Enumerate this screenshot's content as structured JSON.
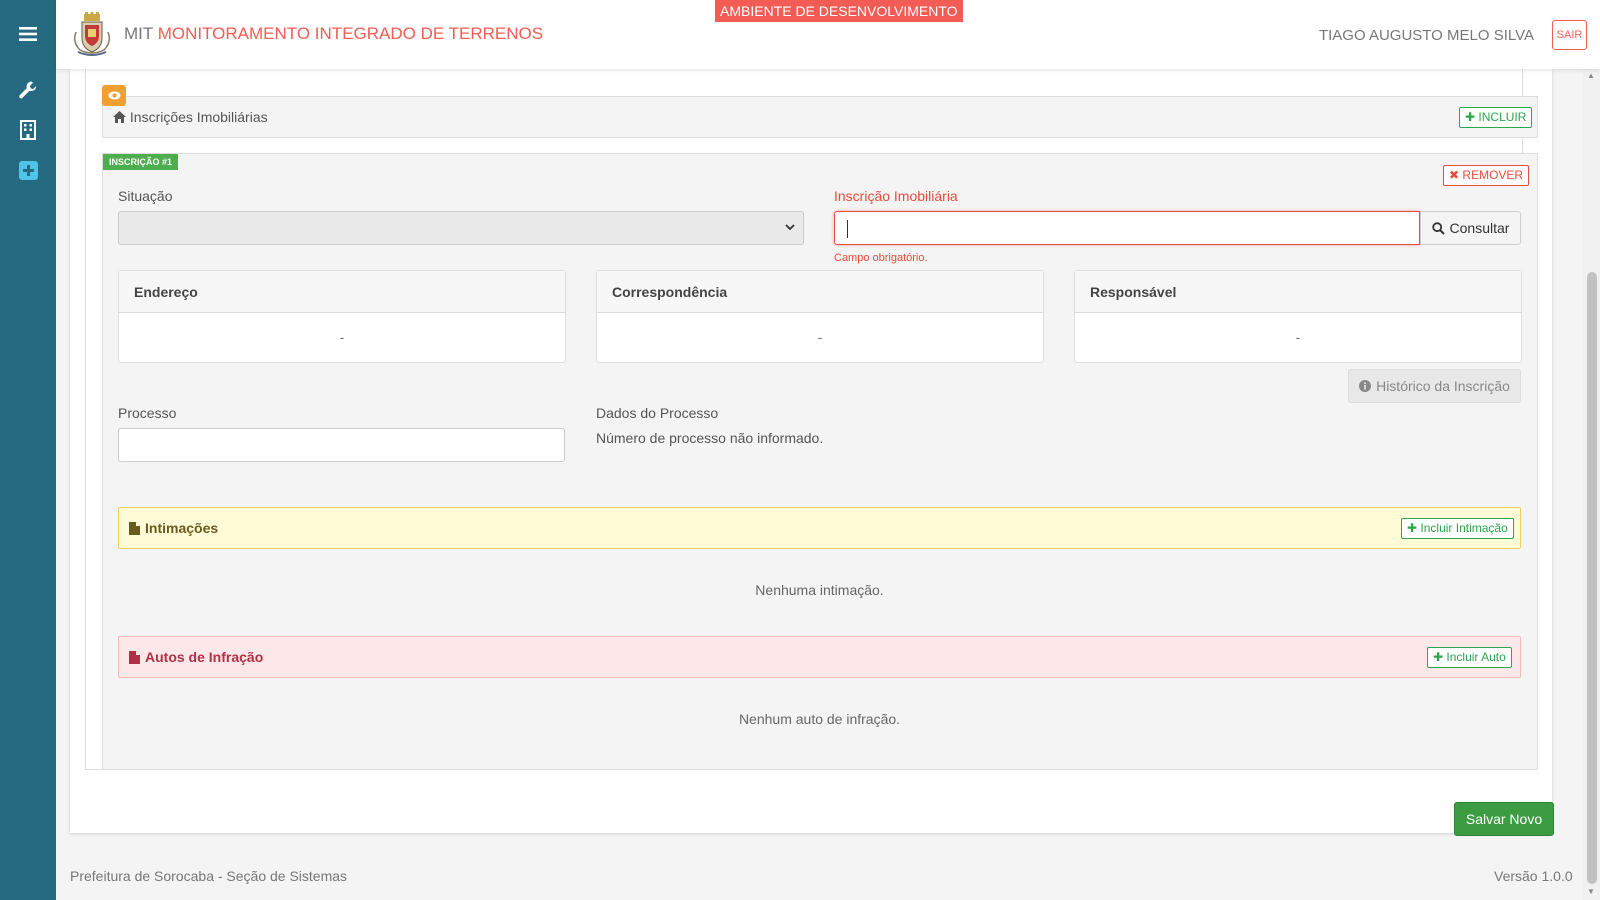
{
  "header": {
    "app_prefix": "MIT",
    "app_title": "MONITORAMENTO INTEGRADO DE TERRENOS",
    "environment_badge": "AMBIENTE DE DESENVOLVIMENTO",
    "user_name": "TIAGO AUGUSTO MELO SILVA",
    "logout_label": "SAIR"
  },
  "sidebar": {
    "items": [
      {
        "icon": "menu-icon"
      },
      {
        "icon": "wrench-icon"
      },
      {
        "icon": "building-icon"
      },
      {
        "icon": "plus-square-icon"
      }
    ]
  },
  "inscricoes": {
    "section_title": "Inscrições Imobiliárias",
    "include_label": "INCLUIR",
    "item_tag": "INSCRIÇÃO #1",
    "remove_label": "REMOVER",
    "situacao_label": "Situação",
    "situacao_value": "",
    "inscricao_label": "Inscrição Imobiliária",
    "inscricao_value": "",
    "consultar_label": "Consultar",
    "required_error": "Campo obrigatório.",
    "endereco_title": "Endereço",
    "endereco_value": "-",
    "correspondencia_title": "Correspondência",
    "correspondencia_value": "-",
    "responsavel_title": "Responsável",
    "responsavel_value": "-",
    "historico_label": "Histórico da Inscrição",
    "processo_label": "Processo",
    "processo_value": "",
    "dados_processo_label": "Dados do Processo",
    "dados_processo_value": "Número de processo não informado."
  },
  "intimacoes": {
    "title": "Intimações",
    "include_label": "Incluir Intimação",
    "empty_message": "Nenhuma intimação."
  },
  "autos": {
    "title": "Autos de Infração",
    "include_label": "Incluir Auto",
    "empty_message": "Nenhum auto de infração."
  },
  "actions": {
    "save_label": "Salvar Novo"
  },
  "footer": {
    "organization": "Prefeitura de Sorocaba - Seção de Sistemas",
    "version": "Versão 1.0.0"
  },
  "colors": {
    "sidebar": "#266a82",
    "accent": "#f25c54",
    "success": "#3c9c42",
    "warning": "#f0a030"
  }
}
